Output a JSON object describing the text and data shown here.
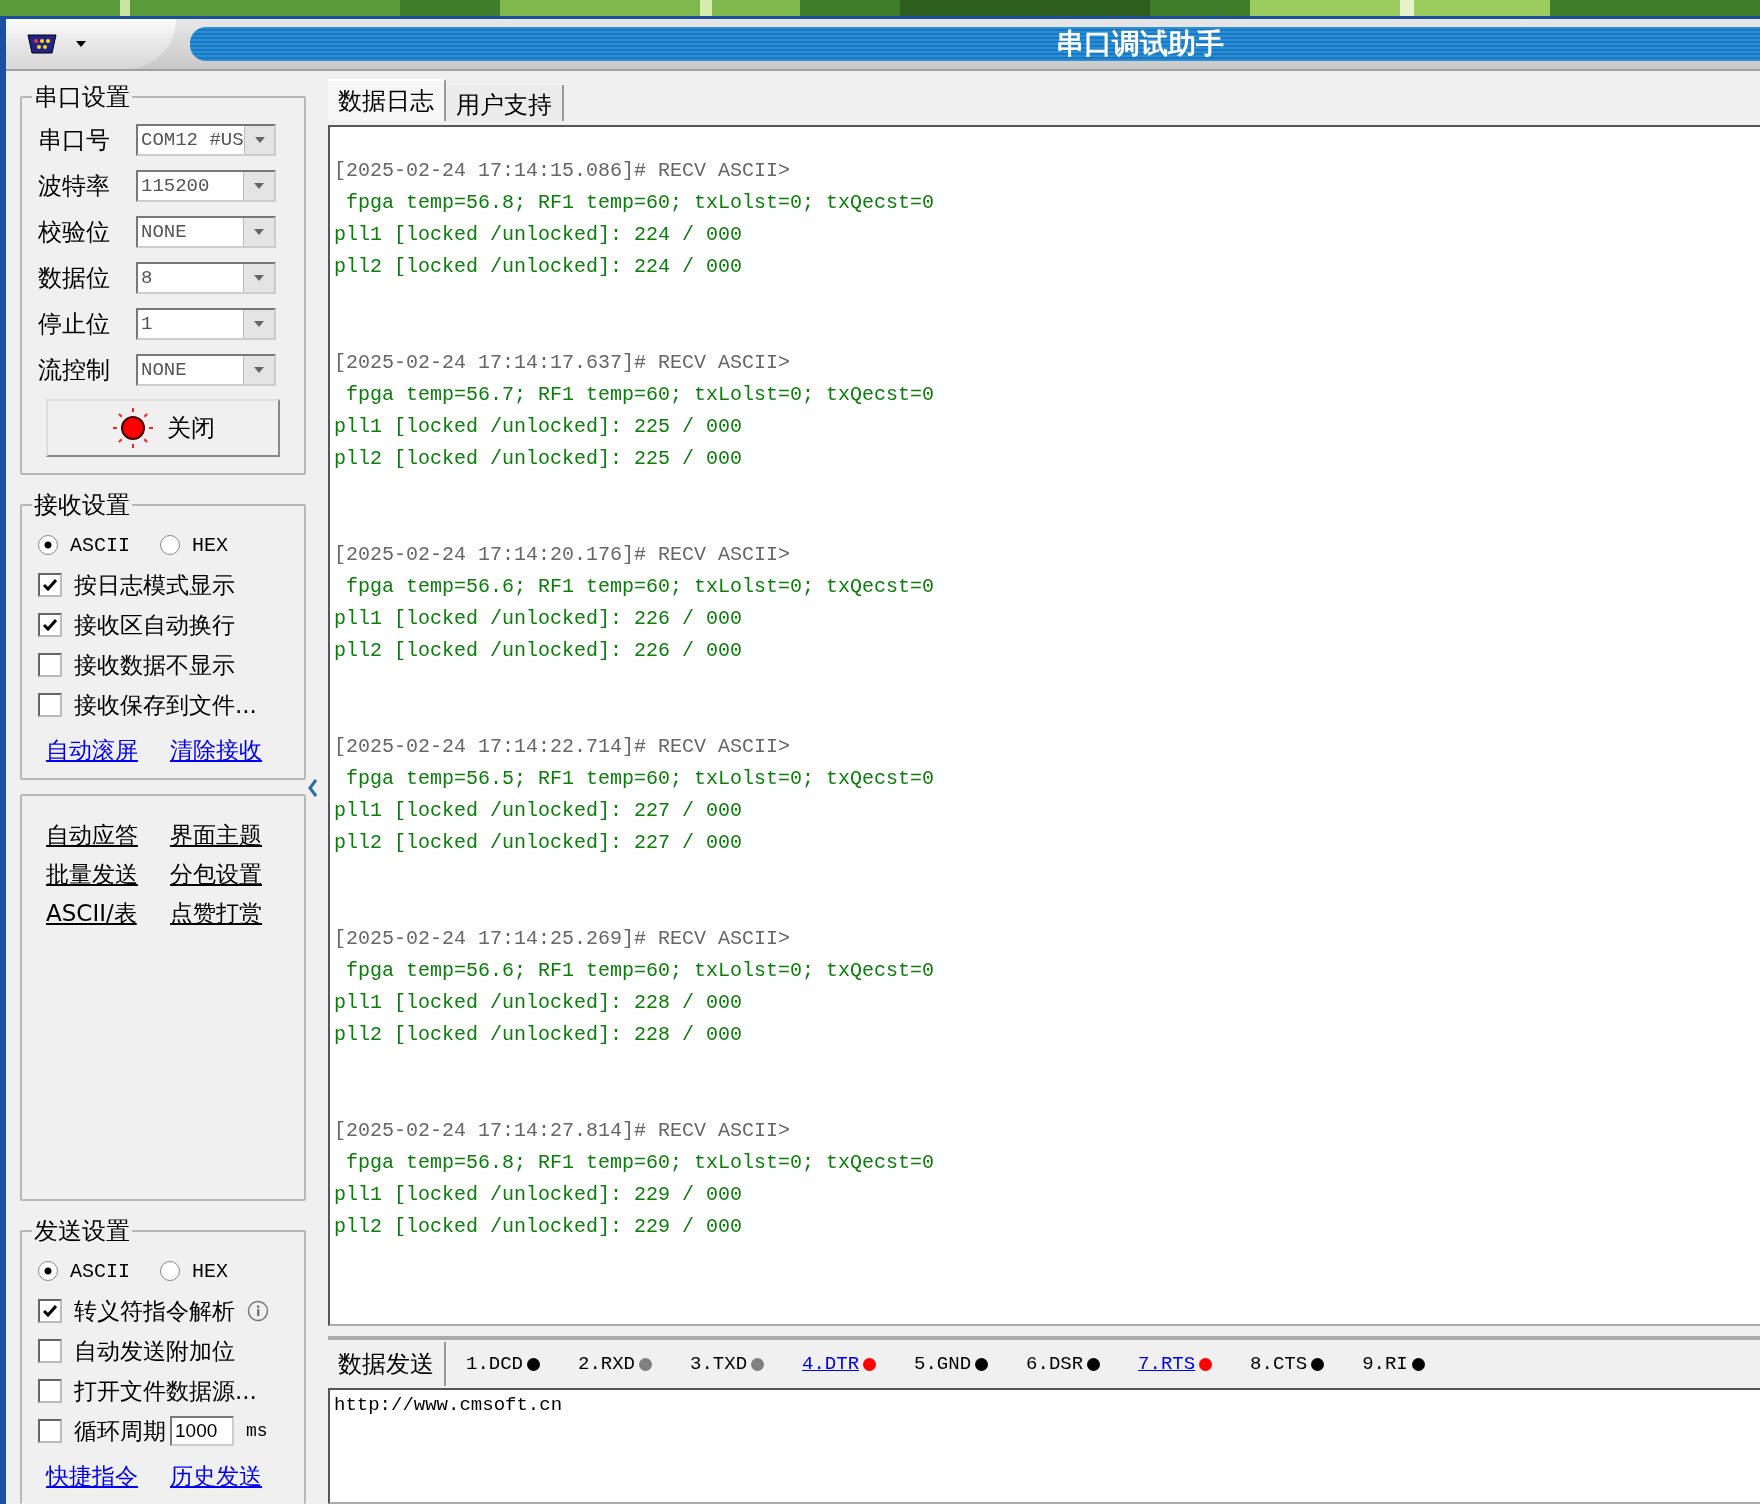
{
  "window": {
    "title": "串口调试助手"
  },
  "port_settings": {
    "title": "串口设置",
    "fields": [
      {
        "label": "串口号",
        "value": "COM12 #US"
      },
      {
        "label": "波特率",
        "value": "115200"
      },
      {
        "label": "校验位",
        "value": "NONE"
      },
      {
        "label": "数据位",
        "value": "8"
      },
      {
        "label": "停止位",
        "value": "1"
      },
      {
        "label": "流控制",
        "value": "NONE"
      }
    ],
    "open_button": {
      "label": "关闭",
      "on": true
    }
  },
  "receive_settings": {
    "title": "接收设置",
    "modes": [
      {
        "label": "ASCII",
        "selected": true
      },
      {
        "label": "HEX",
        "selected": false
      }
    ],
    "options": [
      {
        "label": "按日志模式显示",
        "checked": true
      },
      {
        "label": "接收区自动换行",
        "checked": true
      },
      {
        "label": "接收数据不显示",
        "checked": false
      },
      {
        "label": "接收保存到文件...",
        "checked": false
      }
    ],
    "links": [
      "自动滚屏",
      "清除接收"
    ]
  },
  "tools": [
    "自动应答",
    "界面主题",
    "批量发送",
    "分包设置",
    "ASCII/表",
    "点赞打赏"
  ],
  "send_settings": {
    "title": "发送设置",
    "modes": [
      {
        "label": "ASCII",
        "selected": true
      },
      {
        "label": "HEX",
        "selected": false
      }
    ],
    "options": [
      {
        "label": "转义符指令解析",
        "checked": true,
        "kind": "info"
      },
      {
        "label": "自动发送附加位",
        "checked": false,
        "kind": "plain"
      },
      {
        "label": "打开文件数据源...",
        "checked": false,
        "kind": "plain"
      },
      {
        "label": "循环周期",
        "checked": false,
        "kind": "period",
        "value": "1000",
        "unit": "ms"
      }
    ],
    "links": [
      "快捷指令",
      "历史发送"
    ]
  },
  "tabs": [
    {
      "label": "数据日志",
      "selected": true
    },
    {
      "label": "用户支持",
      "selected": false
    }
  ],
  "log": [
    {
      "header": "[2025-02-24 17:14:15.086]# RECV ASCII>",
      "lines": [
        " fpga temp=56.8; RF1 temp=60; txLolst=0; txQecst=0",
        "pll1 [locked /unlocked]: 224 / 000",
        "pll2 [locked /unlocked]: 224 / 000"
      ]
    },
    {
      "header": "[2025-02-24 17:14:17.637]# RECV ASCII>",
      "lines": [
        " fpga temp=56.7; RF1 temp=60; txLolst=0; txQecst=0",
        "pll1 [locked /unlocked]: 225 / 000",
        "pll2 [locked /unlocked]: 225 / 000"
      ]
    },
    {
      "header": "[2025-02-24 17:14:20.176]# RECV ASCII>",
      "lines": [
        " fpga temp=56.6; RF1 temp=60; txLolst=0; txQecst=0",
        "pll1 [locked /unlocked]: 226 / 000",
        "pll2 [locked /unlocked]: 226 / 000"
      ]
    },
    {
      "header": "[2025-02-24 17:14:22.714]# RECV ASCII>",
      "lines": [
        " fpga temp=56.5; RF1 temp=60; txLolst=0; txQecst=0",
        "pll1 [locked /unlocked]: 227 / 000",
        "pll2 [locked /unlocked]: 227 / 000"
      ]
    },
    {
      "header": "[2025-02-24 17:14:25.269]# RECV ASCII>",
      "lines": [
        " fpga temp=56.6; RF1 temp=60; txLolst=0; txQecst=0",
        "pll1 [locked /unlocked]: 228 / 000",
        "pll2 [locked /unlocked]: 228 / 000"
      ]
    },
    {
      "header": "[2025-02-24 17:14:27.814]# RECV ASCII>",
      "lines": [
        " fpga temp=56.8; RF1 temp=60; txLolst=0; txQecst=0",
        "pll1 [locked /unlocked]: 229 / 000",
        "pll2 [locked /unlocked]: 229 / 000"
      ]
    }
  ],
  "send_tab": {
    "label": "数据发送"
  },
  "pins": [
    {
      "label": "1.DCD",
      "color": "#000000",
      "kind": "plain"
    },
    {
      "label": "2.RXD",
      "color": "#808080",
      "kind": "plain"
    },
    {
      "label": "3.TXD",
      "color": "#808080",
      "kind": "plain"
    },
    {
      "label": "4.DTR",
      "color": "#ff0000",
      "kind": "link"
    },
    {
      "label": "5.GND",
      "color": "#000000",
      "kind": "plain"
    },
    {
      "label": "6.DSR",
      "color": "#000000",
      "kind": "plain"
    },
    {
      "label": "7.RTS",
      "color": "#ff0000",
      "kind": "link"
    },
    {
      "label": "8.CTS",
      "color": "#000000",
      "kind": "plain"
    },
    {
      "label": "9.RI",
      "color": "#000000",
      "kind": "plain"
    }
  ],
  "send_input": {
    "value": "http://www.cmsoft.cn"
  }
}
